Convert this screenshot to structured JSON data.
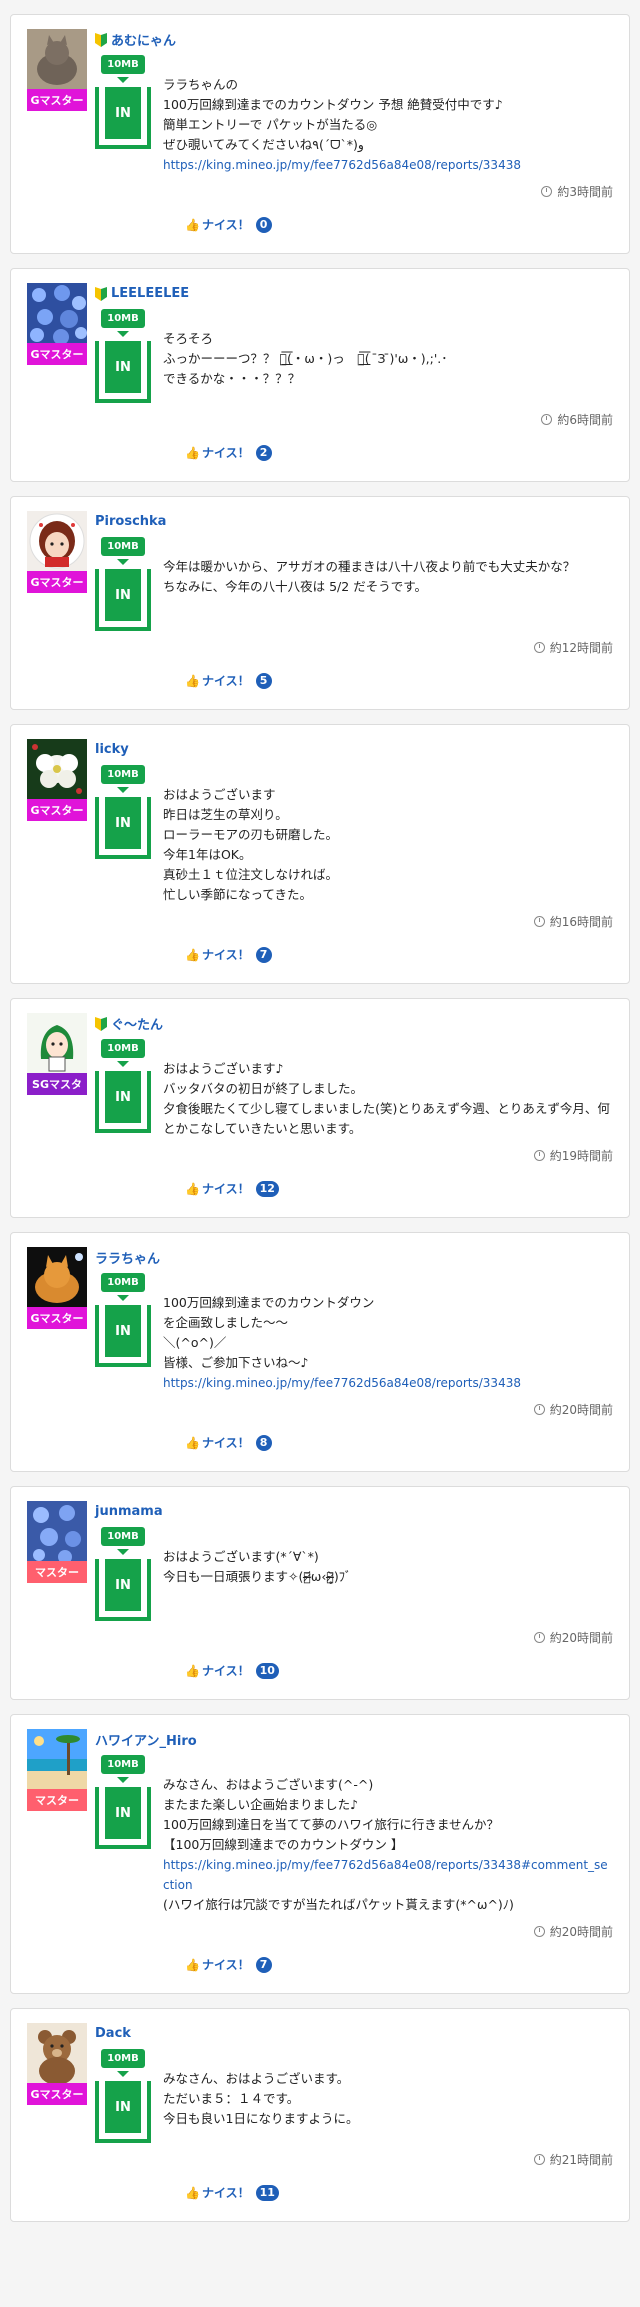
{
  "posts": [
    {
      "name": "あむにゃん",
      "beginner": true,
      "rank": "Gマスター",
      "rank_color": "#e014d9",
      "avatar": "cat",
      "mb": "10MB",
      "in_label": "IN",
      "lines": [
        "ララちゃんの",
        "100万回線到達までのカウントダウン 予想 絶賛受付中です♪",
        "簡単エントリーで パケットが当たる◎",
        "ぜひ覗いてみてくださいね٩(ˊᗜˋ*)و"
      ],
      "link": "https://king.mineo.jp/my/fee7762d56a84e08/reports/33438",
      "after_lines": [],
      "time": "約3時間前",
      "nice_label": "ナイス！",
      "nice_count": "0"
    },
    {
      "name": "LEELEELEE",
      "beginner": true,
      "rank": "Gマスター",
      "rank_color": "#e014d9",
      "avatar": "flowers-blue",
      "mb": "10MB",
      "in_label": "IN",
      "lines": [
        "そろそろ",
        "ふっかーーーつ？？ ＝͟͟͞͞(・ω・)っ　＝͟͟͞͞(  ̄З ̄)'ω・),;'.･",
        "できるかな・・・？？？"
      ],
      "link": "",
      "after_lines": [],
      "time": "約6時間前",
      "nice_label": "ナイス！",
      "nice_count": "2"
    },
    {
      "name": "Piroschka",
      "beginner": false,
      "rank": "Gマスター",
      "rank_color": "#e014d9",
      "avatar": "girl",
      "mb": "10MB",
      "in_label": "IN",
      "lines": [
        "今年は暖かいから、アサガオの種まきは八十八夜より前でも大丈夫かな？",
        "ちなみに、今年の八十八夜は 5/2 だそうです。"
      ],
      "link": "",
      "after_lines": [],
      "time": "約12時間前",
      "nice_label": "ナイス！",
      "nice_count": "5"
    },
    {
      "name": "licky",
      "beginner": false,
      "rank": "Gマスター",
      "rank_color": "#e014d9",
      "avatar": "white-flower",
      "mb": "10MB",
      "in_label": "IN",
      "lines": [
        "おはようございます",
        "昨日は芝生の草刈り。",
        "ローラーモアの刃も研磨した。",
        "今年1年はOK。",
        "真砂土１ｔ位注文しなければ。",
        "忙しい季節になってきた。"
      ],
      "link": "",
      "after_lines": [],
      "time": "約16時間前",
      "nice_label": "ナイス！",
      "nice_count": "7"
    },
    {
      "name": "ぐ〜たん",
      "beginner": true,
      "rank": "SGマスタ",
      "rank_color": "#8b1fc9",
      "avatar": "anime",
      "mb": "10MB",
      "in_label": "IN",
      "lines": [
        "おはようございます♪",
        "バッタバタの初日が終了しました。",
        "夕食後眠たくて少し寝てしまいました(笑)とりあえず今週、とりあえず今月、何とかこなしていきたいと思います。"
      ],
      "link": "",
      "after_lines": [],
      "time": "約19時間前",
      "nice_label": "ナイス！",
      "nice_count": "12"
    },
    {
      "name": "ララちゃん",
      "beginner": false,
      "rank": "Gマスター",
      "rank_color": "#e014d9",
      "avatar": "orange-cat",
      "mb": "10MB",
      "in_label": "IN",
      "lines": [
        "100万回線到達までのカウントダウン",
        "を企画致しました〜〜",
        "＼(^o^)／",
        "皆様、ご参加下さいね〜♪"
      ],
      "link": "https://king.mineo.jp/my/fee7762d56a84e08/reports/33438",
      "after_lines": [],
      "time": "約20時間前",
      "nice_label": "ナイス！",
      "nice_count": "8"
    },
    {
      "name": "junmama",
      "beginner": false,
      "rank": "マスター",
      "rank_color": "#ff5f6e",
      "avatar": "flowers-blue2",
      "mb": "10MB",
      "in_label": "IN",
      "lines": [
        "おはようございます(*´∀`*)",
        "今日も一日頑張ります✧(ｏ̴̶̷᷄ω‹ｏ̴̶̷̥᷅)ﾌﾞ"
      ],
      "link": "",
      "after_lines": [],
      "time": "約20時間前",
      "nice_label": "ナイス！",
      "nice_count": "10"
    },
    {
      "name": "ハワイアン_Hiro",
      "beginner": false,
      "rank": "マスター",
      "rank_color": "#ff5f6e",
      "avatar": "beach",
      "mb": "10MB",
      "in_label": "IN",
      "lines": [
        "みなさん、おはようございます(^-^)",
        "またまた楽しい企画始まりました♪",
        "100万回線到達日を当てて夢のハワイ旅行に行きませんか？",
        "【100万回線到達までのカウントダウン 】"
      ],
      "link": "https://king.mineo.jp/my/fee7762d56a84e08/reports/33438#comment_section",
      "after_lines": [
        "(ハワイ旅行は冗談ですが当たればパケット貰えます(*^ω^)ﾉ)"
      ],
      "time": "約20時間前",
      "nice_label": "ナイス！",
      "nice_count": "7"
    },
    {
      "name": "Dack",
      "beginner": false,
      "rank": "Gマスター",
      "rank_color": "#e014d9",
      "avatar": "teddy",
      "mb": "10MB",
      "in_label": "IN",
      "lines": [
        "みなさん、おはようございます。",
        "ただいま５：１４です。",
        "今日も良い1日になりますように。"
      ],
      "link": "",
      "after_lines": [],
      "time": "約21時間前",
      "nice_label": "ナイス！",
      "nice_count": "11"
    }
  ]
}
